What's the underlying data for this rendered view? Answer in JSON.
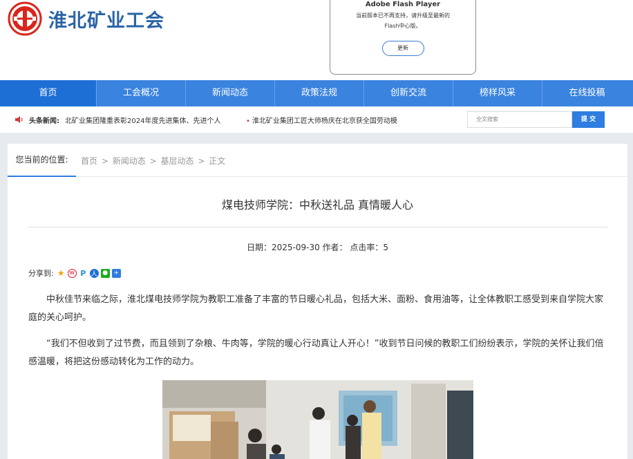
{
  "header": {
    "logo_text": "淮北矿业工会"
  },
  "flash": {
    "title": "Adobe Flash Player",
    "desc": "当前版本已不再支持，请升级至最新的Flash中心版。",
    "button": "更新"
  },
  "nav": {
    "items": [
      {
        "label": "首页"
      },
      {
        "label": "工会概况"
      },
      {
        "label": "新闻动态"
      },
      {
        "label": "政策法规"
      },
      {
        "label": "创新交流"
      },
      {
        "label": "榜样风采"
      },
      {
        "label": "在线投稿"
      }
    ]
  },
  "ticker": {
    "label": "头条新闻:",
    "item1": "北矿业集团隆重表彰2024年度先进集体、先进个人",
    "item2": "淮北矿业集团工匠大师杨庆在北京获全国劳动模"
  },
  "search": {
    "placeholder": "全文搜索",
    "button": "提 交"
  },
  "breadcrumb": {
    "here_label": "您当前的位置:",
    "items": [
      "首页",
      "新闻动态",
      "基层动态",
      "正文"
    ],
    "sep": ">"
  },
  "article": {
    "title": "煤电技师学院：中秋送礼品 真情暖人心",
    "meta": "日期：2025-09-30 作者： 点击率：5",
    "share_label": "分享到:",
    "p1": "中秋佳节来临之际，淮北煤电技师学院为教职工准备了丰富的节日暖心礼品，包括大米、面粉、食用油等，让全体教职工感受到来自学院大家庭的关心呵护。",
    "p2": "“我们不但收到了过节费，而且领到了杂粮、牛肉等，学院的暖心行动真让人开心！”收到节日问候的教职工们纷纷表示，学院的关怀让我们倍感温暖，将把这份感动转化为工作的动力。"
  },
  "colors": {
    "nav_bg": "#3a83df",
    "nav_active": "#1e6fd5",
    "logo_red": "#d9261c",
    "logo_blue": "#2a64a6"
  }
}
